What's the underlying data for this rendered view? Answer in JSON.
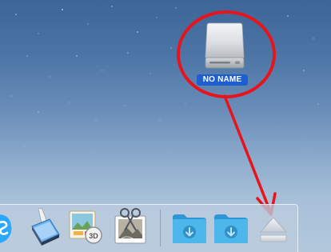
{
  "desktop": {
    "drive": {
      "label": "NO NAME",
      "icon": "external-drive-icon"
    }
  },
  "annotation": {
    "circle_color": "#e8141b",
    "arrow_color": "#e8141b"
  },
  "dock": {
    "items": [
      {
        "icon": "skype-icon",
        "color": "#2aa7ff"
      },
      {
        "icon": "image-capture-scanner-icon"
      },
      {
        "icon": "preview-3d-icon"
      },
      {
        "icon": "photo-editor-icon"
      },
      {
        "icon": "downloads-folder-icon",
        "color": "#35a9e2"
      },
      {
        "icon": "downloads-stack-icon",
        "color": "#35a9e2"
      },
      {
        "icon": "eject-icon"
      }
    ]
  }
}
